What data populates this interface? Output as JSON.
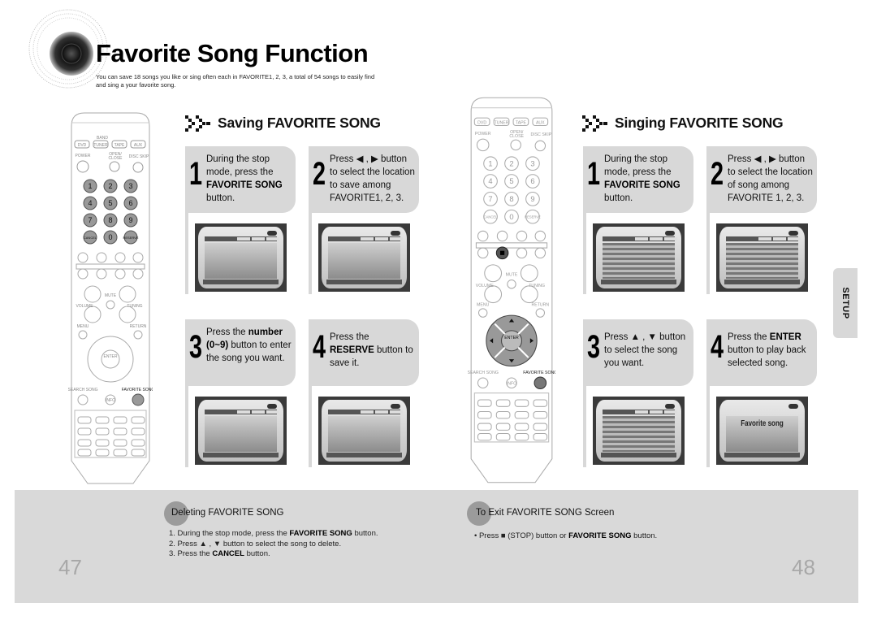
{
  "header": {
    "title": "Favorite Song Function",
    "intro_line1": "You can save 18 songs you like or sing often each in FAVORITE1, 2, 3, a total of 54 songs to easily find",
    "intro_line2": "and sing a your favorite song."
  },
  "saving": {
    "heading": "Saving FAVORITE SONG",
    "steps": [
      {
        "num": "1",
        "pre": "During the stop mode, press the ",
        "bold": "FAVORITE SONG",
        "post": " button."
      },
      {
        "num": "2",
        "pre": "Press ◀ , ▶ button to select the location to save among FAVORITE1, 2, 3.",
        "bold": "",
        "post": ""
      },
      {
        "num": "3",
        "pre": "Press the ",
        "bold": "number (0~9)",
        "post": " button to enter the song you want."
      },
      {
        "num": "4",
        "pre": "Press the ",
        "bold": "RESERVE",
        "post": " button to save it."
      }
    ]
  },
  "singing": {
    "heading": "Singing FAVORITE SONG",
    "steps": [
      {
        "num": "1",
        "pre": "During the stop mode, press the ",
        "bold": "FAVORITE SONG",
        "post": " button."
      },
      {
        "num": "2",
        "pre": "Press ◀ , ▶ button to select the location of song among FAVORITE 1, 2, 3.",
        "bold": "",
        "post": ""
      },
      {
        "num": "3",
        "pre": "Press ▲ , ▼  button to select the song you want.",
        "bold": "",
        "post": ""
      },
      {
        "num": "4",
        "pre": "Press the ",
        "bold": "ENTER",
        "post": " button to play back selected song."
      }
    ],
    "playback_caption": "Favorite song"
  },
  "deleting": {
    "title": "Deleting FAVORITE SONG",
    "items": [
      {
        "pre": "1. During the stop mode, press the ",
        "bold": "FAVORITE SONG",
        "post": " button."
      },
      {
        "pre": "2. Press ▲ , ▼ button to select the song to delete.",
        "bold": "",
        "post": ""
      },
      {
        "pre": "3. Press the ",
        "bold": "CANCEL",
        "post": " button."
      }
    ]
  },
  "exit": {
    "title": "To Exit FAVORITE SONG Screen",
    "items": [
      {
        "pre": "•  Press ■  (STOP) button or ",
        "bold": "FAVORITE SONG",
        "post": " button."
      }
    ]
  },
  "side_tab": "SETUP",
  "page_numbers": {
    "left": "47",
    "right": "48"
  },
  "remote": {
    "source_buttons": [
      "DVD",
      "TUNER",
      "TAPE",
      "AUX"
    ],
    "band_label": "BAND",
    "power_label": "POWER",
    "open_close_label": "OPEN/ CLOSE",
    "disc_skip_label": "DISC SKIP",
    "number_keys": [
      "1",
      "2",
      "3",
      "4",
      "5",
      "6",
      "7",
      "8",
      "9",
      "CANCEL",
      "0",
      "RESERVE"
    ],
    "volume_label": "VOLUME",
    "tuning_label": "TUNING",
    "mute_label": "MUTE",
    "menu_label": "MENU",
    "return_label": "RETURN",
    "enter_label": "ENTER",
    "search_song_label": "SEARCH SONG",
    "info_label": "INFO",
    "favorite_song_label": "FAVORITE SONG"
  }
}
